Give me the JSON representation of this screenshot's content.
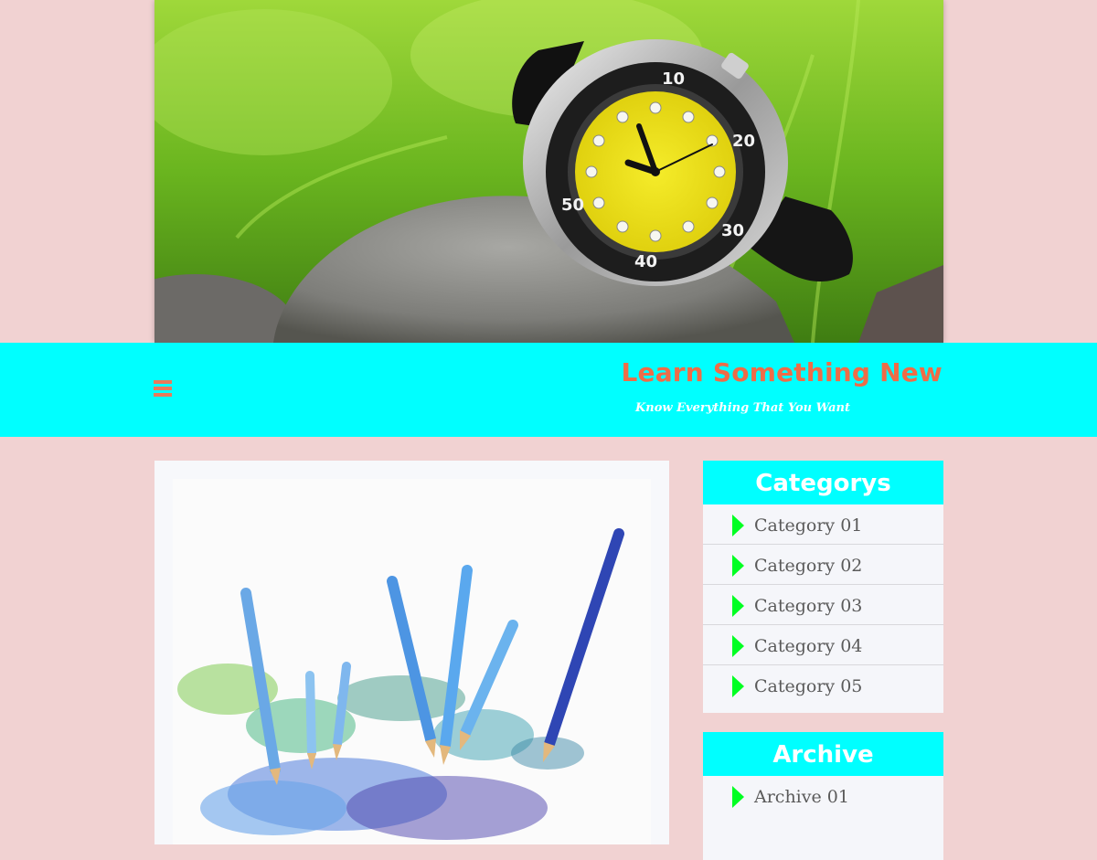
{
  "site": {
    "title": "Learn Something New",
    "tagline": "Know Everything That You Want"
  },
  "icons": {
    "menu": "hamburger-menu-icon",
    "list_bullet": "triangle-right-icon"
  },
  "colors": {
    "page_background": "#f1d2d2",
    "header_bar": "#00ffff",
    "site_title": "#ee6c47",
    "widget_title_bg": "#00ffff",
    "bullet": "#00ff22"
  },
  "sidebar": {
    "categories": {
      "title": "Categorys",
      "items": [
        {
          "label": "Category 01"
        },
        {
          "label": "Category 02"
        },
        {
          "label": "Category 03"
        },
        {
          "label": "Category 04"
        },
        {
          "label": "Category 05"
        }
      ]
    },
    "archive": {
      "title": "Archive",
      "items": [
        {
          "label": "Archive 01"
        }
      ]
    }
  }
}
